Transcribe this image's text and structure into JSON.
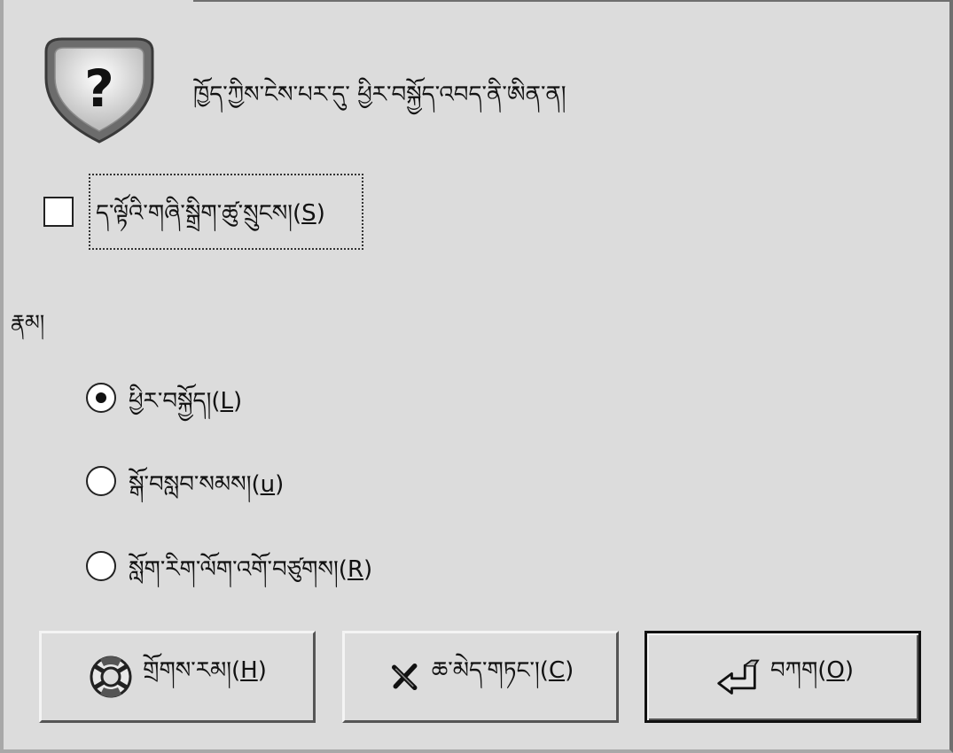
{
  "dialog": {
    "prompt": "ཁྱོད་ཀྱིས་ངེས་པར་དུ་ ཕྱིར་བསྐྱོད་འབད་ནི་ཨིན་ན།",
    "question_icon": "question-icon"
  },
  "checkbox": {
    "label_main": "ད་ལྟོའི་གཞི་སྒྲིག་ཚུ་སྲུངས།(",
    "label_key": "S",
    "label_end": ")",
    "checked": false
  },
  "format": {
    "label": "རྣམ།"
  },
  "options": [
    {
      "label_main": "ཕྱིར་བསྐྱོད།(",
      "label_key": "L",
      "label_end": ")",
      "selected": true
    },
    {
      "label_main": "སྒོ་བསླབ་སམས།(",
      "label_key": "u",
      "label_end": ")",
      "selected": false
    },
    {
      "label_main": "སློག་རིག་ལོག་འགོ་བཙུགས།(",
      "label_key": "R",
      "label_end": ")",
      "selected": false
    }
  ],
  "buttons": {
    "help": {
      "label_main": "གྲོགས་རམ།(",
      "label_key": "H",
      "label_end": ")",
      "icon": "lifebuoy-icon"
    },
    "cancel": {
      "label_main": "ཆ་མེད་གཏང་།(",
      "label_key": "C",
      "label_end": ")",
      "icon": "close-x-icon"
    },
    "ok": {
      "label_main": "བཀག(",
      "label_key": "O",
      "label_end": ")",
      "icon": "return-arrow-icon"
    }
  }
}
